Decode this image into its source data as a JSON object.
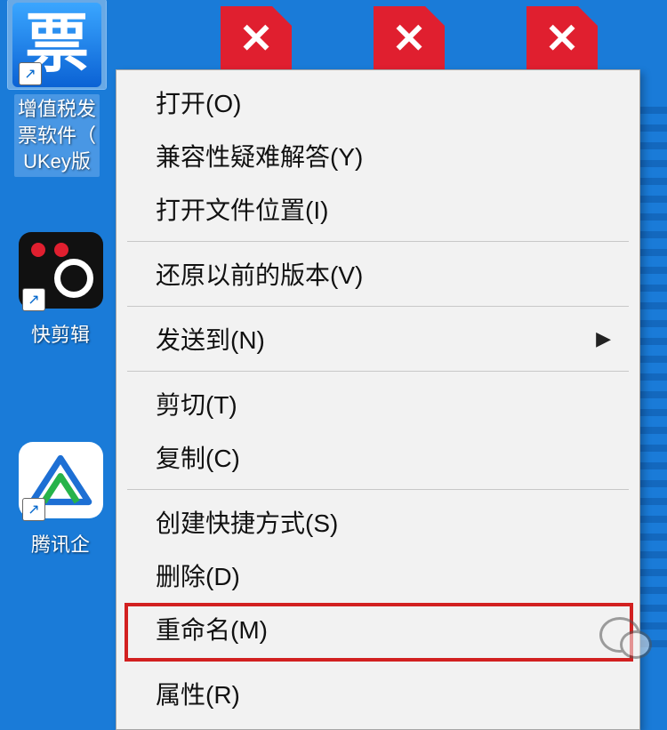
{
  "desktop": {
    "icons": [
      {
        "id": "piao",
        "label": "增值税发\n票软件（\nUKey版",
        "selected": true
      },
      {
        "id": "kuaijian",
        "label": "快剪辑"
      },
      {
        "id": "tencent",
        "label": "腾讯企"
      }
    ]
  },
  "context_menu": {
    "groups": [
      [
        {
          "label": "打开(O)"
        },
        {
          "label": "兼容性疑难解答(Y)"
        },
        {
          "label": "打开文件位置(I)"
        }
      ],
      [
        {
          "label": "还原以前的版本(V)"
        }
      ],
      [
        {
          "label": "发送到(N)",
          "submenu": true
        }
      ],
      [
        {
          "label": "剪切(T)"
        },
        {
          "label": "复制(C)"
        }
      ],
      [
        {
          "label": "创建快捷方式(S)"
        },
        {
          "label": "删除(D)"
        },
        {
          "label": "重命名(M)"
        }
      ],
      [
        {
          "label": "属性(R)",
          "highlight": true
        }
      ]
    ]
  },
  "watermark": {
    "text": ""
  }
}
